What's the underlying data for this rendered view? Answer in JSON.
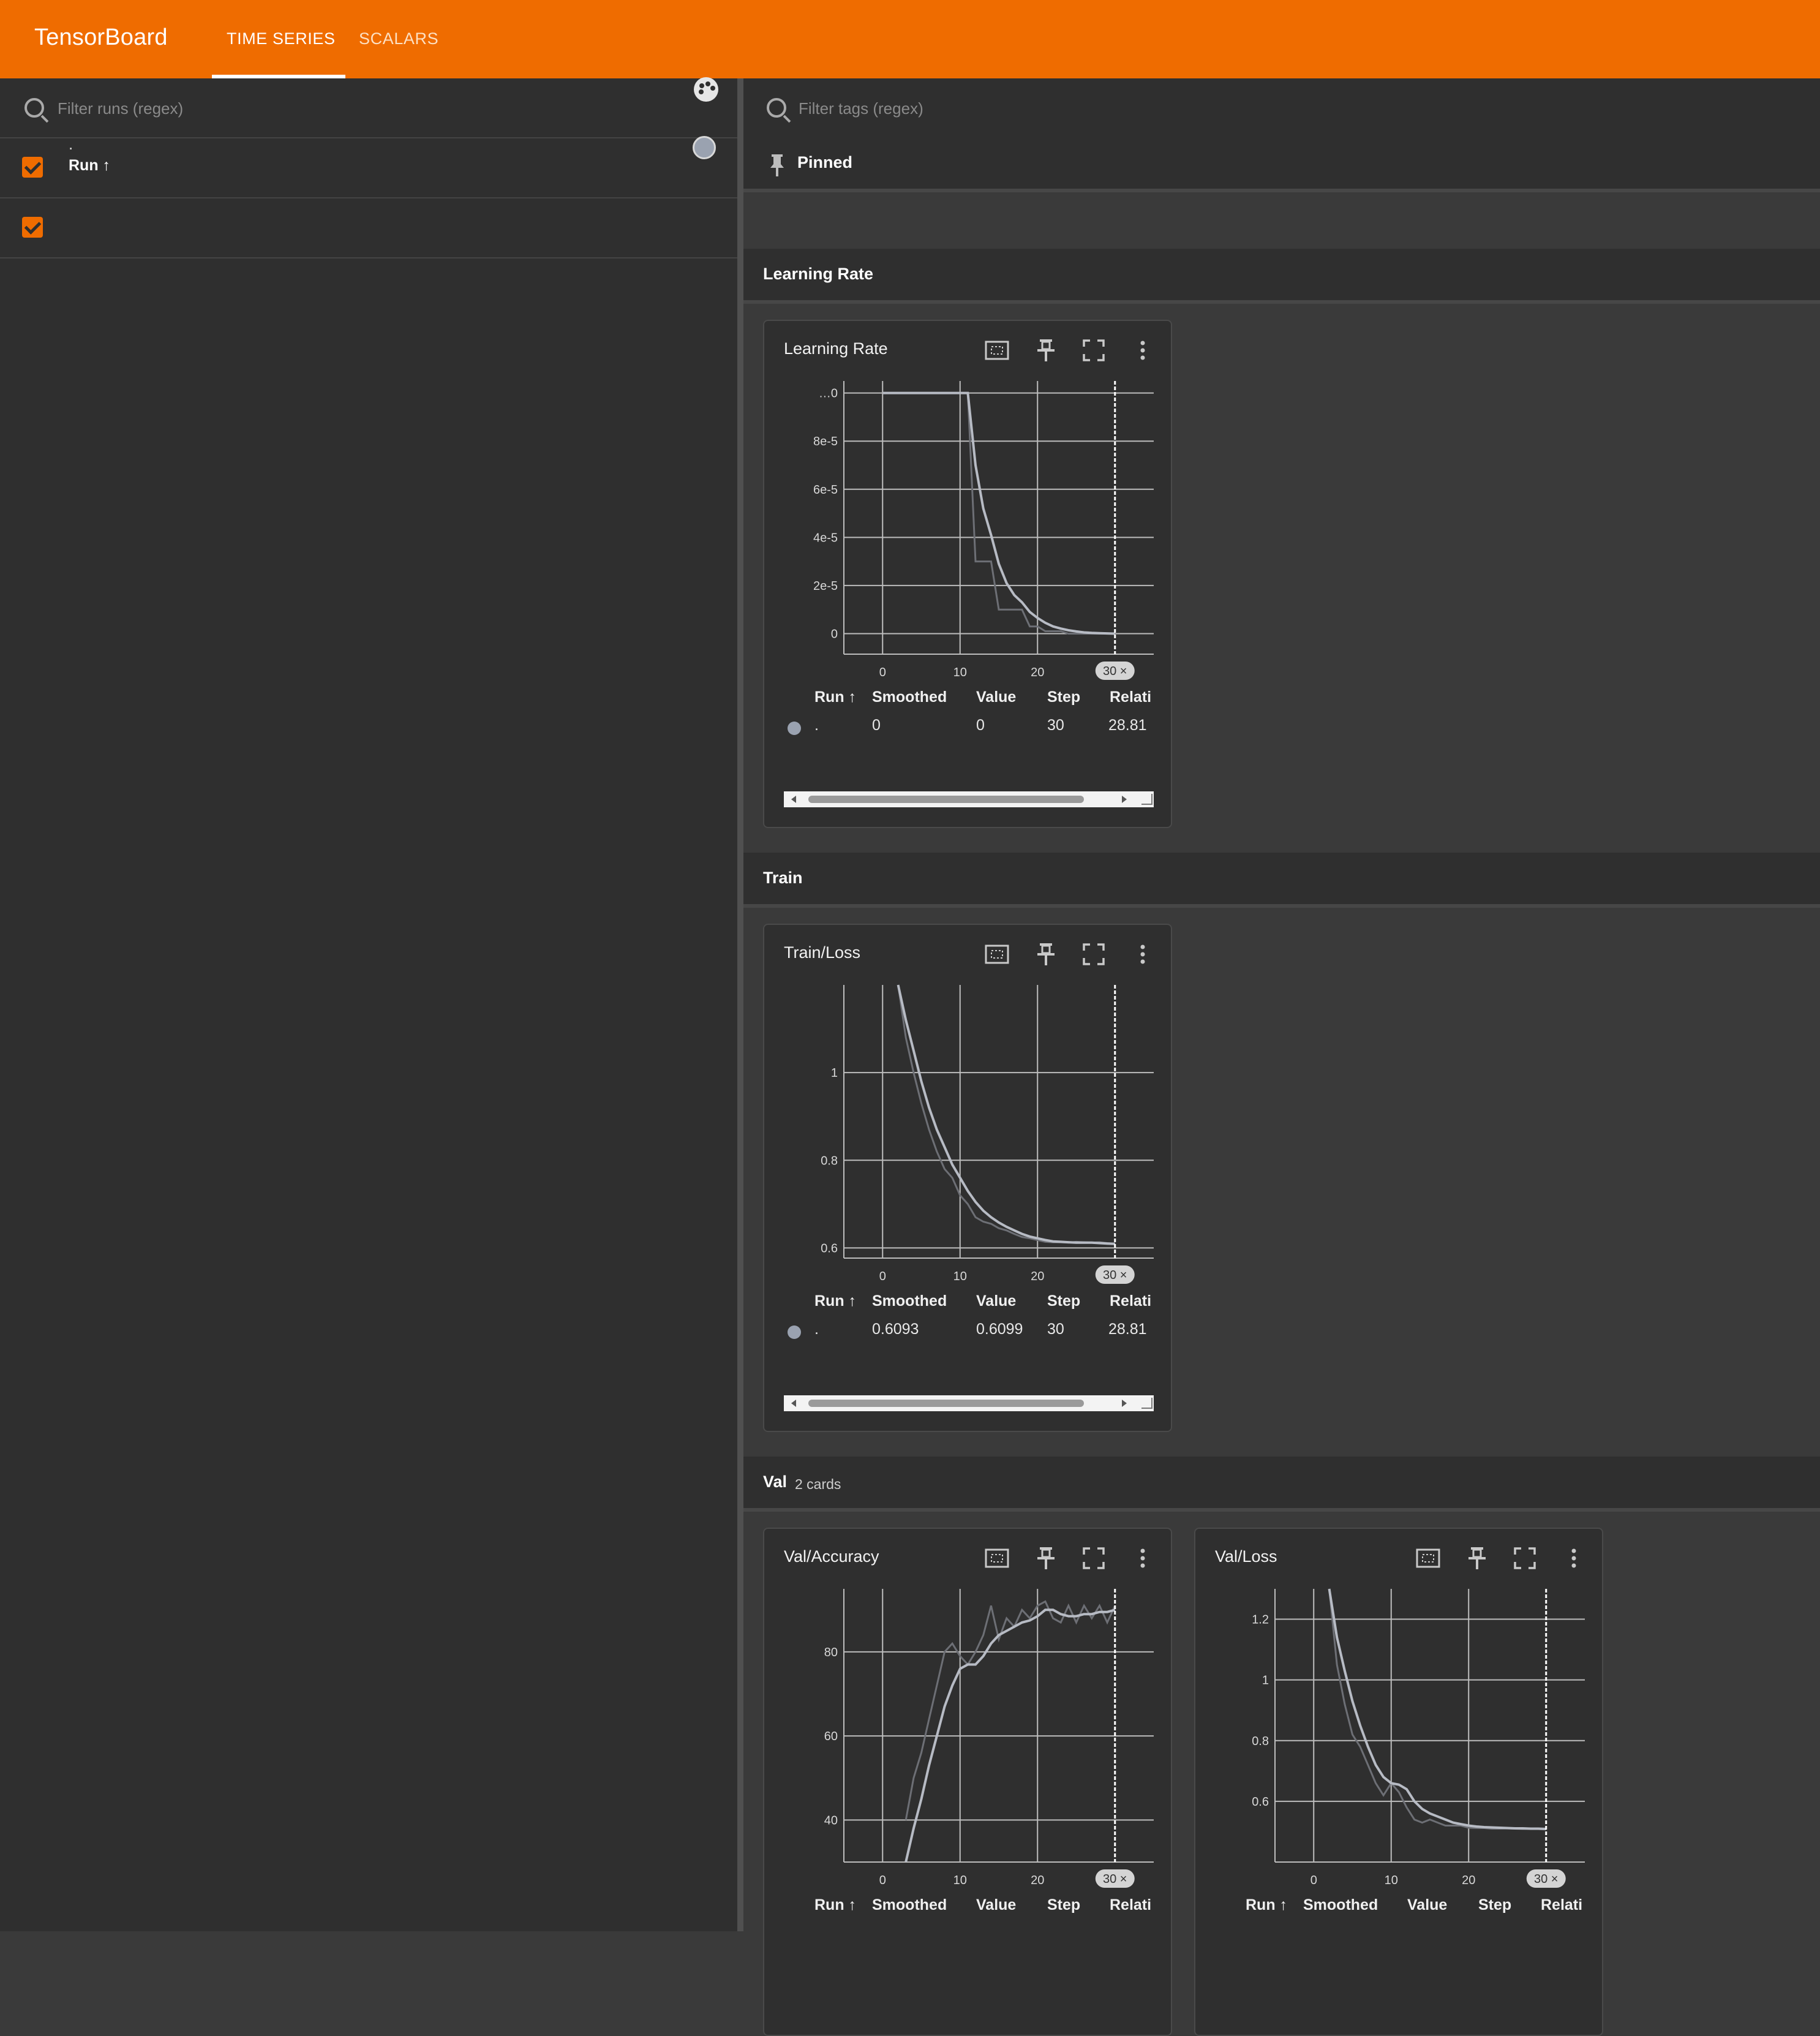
{
  "app": {
    "brand": "TensorBoard",
    "tabs": [
      {
        "label": "TIME SERIES",
        "active": true
      },
      {
        "label": "SCALARS",
        "active": false
      }
    ],
    "accent": "#ef6c00"
  },
  "sidebar": {
    "filter_placeholder": "Filter runs (regex)",
    "run_header": "Run ↑",
    "runs": [
      {
        "name": ".",
        "checked": true,
        "color": "#9aa2b0"
      }
    ]
  },
  "main": {
    "filter_placeholder": "Filter tags (regex)",
    "pinned_label": "Pinned",
    "sections": [
      {
        "title": "Learning Rate",
        "subtitle": ""
      },
      {
        "title": "Train",
        "subtitle": ""
      },
      {
        "title": "Val",
        "subtitle": "2 cards"
      }
    ],
    "table_headers": {
      "run": "Run ↑",
      "smoothed": "Smoothed",
      "value": "Value",
      "step": "Step",
      "relative": "Relati"
    },
    "step_badge": "30 ×",
    "cards": [
      {
        "title": "Learning Rate",
        "row": {
          "run": ".",
          "smoothed": "0",
          "value": "0",
          "step": "30",
          "relative": "28.81"
        }
      },
      {
        "title": "Train/Loss",
        "row": {
          "run": ".",
          "smoothed": "0.6093",
          "value": "0.6099",
          "step": "30",
          "relative": "28.81"
        }
      },
      {
        "title": "Val/Accuracy"
      },
      {
        "title": "Val/Loss"
      }
    ]
  },
  "chart_data": [
    {
      "type": "line",
      "title": "Learning Rate",
      "x_ticks": [
        "0",
        "10",
        "20"
      ],
      "y_ticks": [
        "0",
        "2e-5",
        "4e-5",
        "6e-5",
        "8e-5",
        "…0"
      ],
      "xlim": [
        -5,
        35
      ],
      "ylim": [
        -8.54e-06,
        0.000105
      ],
      "step_marker": 30,
      "series": [
        {
          "role": "raw",
          "color": "#6d6f75",
          "x": [
            0,
            1,
            2,
            3,
            4,
            5,
            6,
            7,
            8,
            9,
            10,
            11,
            12,
            13,
            14,
            15,
            16,
            17,
            18,
            19,
            20,
            21,
            22,
            23,
            24,
            25,
            26,
            27,
            28,
            29,
            30
          ],
          "y": [
            0.0001,
            0.0001,
            0.0001,
            0.0001,
            0.0001,
            0.0001,
            0.0001,
            0.0001,
            0.0001,
            0.0001,
            0.0001,
            0.0001,
            3e-05,
            3e-05,
            3e-05,
            1e-05,
            1e-05,
            1e-05,
            1e-05,
            3e-06,
            3e-06,
            1e-06,
            1e-06,
            1e-06,
            0,
            0,
            0,
            0,
            0,
            0,
            0
          ]
        },
        {
          "role": "smoothed",
          "color": "#b7bbc4",
          "x": [
            0,
            1,
            2,
            3,
            4,
            5,
            6,
            7,
            8,
            9,
            10,
            11,
            12,
            13,
            14,
            15,
            16,
            17,
            18,
            19,
            20,
            21,
            22,
            23,
            24,
            25,
            26,
            27,
            28,
            29,
            30
          ],
          "y": [
            0.0001,
            0.0001,
            0.0001,
            0.0001,
            0.0001,
            0.0001,
            0.0001,
            0.0001,
            0.0001,
            0.0001,
            0.0001,
            0.0001,
            7e-05,
            5.2e-05,
            4.1e-05,
            2.9e-05,
            2.1e-05,
            1.6e-05,
            1.3e-05,
            9e-06,
            6.5e-06,
            4.5e-06,
            3e-06,
            2.1e-06,
            1.4e-06,
            9e-07,
            5e-07,
            3e-07,
            2e-07,
            1e-07,
            0
          ]
        }
      ]
    },
    {
      "type": "line",
      "title": "Train/Loss",
      "x_ticks": [
        "0",
        "10",
        "20"
      ],
      "y_ticks": [
        "0.6",
        "0.8",
        "1"
      ],
      "xlim": [
        -5,
        35
      ],
      "ylim": [
        0.5768,
        1.2
      ],
      "step_marker": 30,
      "series": [
        {
          "role": "raw",
          "color": "#6d6f75",
          "x": [
            2,
            3,
            4,
            5,
            6,
            7,
            8,
            9,
            10,
            11,
            12,
            13,
            14,
            15,
            16,
            17,
            18,
            19,
            20,
            21,
            22,
            23,
            24,
            25,
            26,
            27,
            28,
            29,
            30
          ],
          "y": [
            1.2,
            1.08,
            1.0,
            0.93,
            0.87,
            0.82,
            0.78,
            0.76,
            0.72,
            0.7,
            0.67,
            0.66,
            0.655,
            0.645,
            0.64,
            0.632,
            0.625,
            0.622,
            0.618,
            0.614,
            0.613,
            0.613,
            0.612,
            0.614,
            0.613,
            0.612,
            0.613,
            0.611,
            0.6099
          ]
        },
        {
          "role": "smoothed",
          "color": "#b7bbc4",
          "x": [
            2,
            3,
            4,
            5,
            6,
            7,
            8,
            9,
            10,
            11,
            12,
            13,
            14,
            15,
            16,
            17,
            18,
            19,
            20,
            21,
            22,
            23,
            24,
            25,
            26,
            27,
            28,
            29,
            30
          ],
          "y": [
            1.2,
            1.12,
            1.05,
            0.98,
            0.92,
            0.87,
            0.83,
            0.79,
            0.76,
            0.73,
            0.705,
            0.685,
            0.67,
            0.658,
            0.648,
            0.64,
            0.632,
            0.626,
            0.622,
            0.618,
            0.615,
            0.614,
            0.613,
            0.612,
            0.612,
            0.612,
            0.611,
            0.61,
            0.6093
          ]
        }
      ]
    },
    {
      "type": "line",
      "title": "Val/Accuracy",
      "x_ticks": [
        "0",
        "10",
        "20"
      ],
      "y_ticks": [
        "40",
        "60",
        "80"
      ],
      "xlim": [
        -5,
        35
      ],
      "ylim": [
        30,
        95
      ],
      "step_marker": 30,
      "series": [
        {
          "role": "raw",
          "color": "#6d6f75",
          "x": [
            3,
            4,
            5,
            6,
            7,
            8,
            9,
            10,
            11,
            12,
            13,
            14,
            15,
            16,
            17,
            18,
            19,
            20,
            21,
            22,
            23,
            24,
            25,
            26,
            27,
            28,
            29,
            30
          ],
          "y": [
            40,
            50,
            56,
            64,
            72,
            80,
            82,
            79,
            77,
            80,
            84,
            91,
            83,
            88,
            86,
            90,
            88,
            91,
            92,
            88,
            87,
            91,
            87,
            91,
            88,
            91,
            87,
            91
          ]
        },
        {
          "role": "smoothed",
          "color": "#b7bbc4",
          "x": [
            3,
            4,
            5,
            6,
            7,
            8,
            9,
            10,
            11,
            12,
            13,
            14,
            15,
            16,
            17,
            18,
            19,
            20,
            21,
            22,
            23,
            24,
            25,
            26,
            27,
            28,
            29,
            30
          ],
          "y": [
            30,
            38,
            45,
            53,
            60,
            67,
            72,
            76,
            77,
            77,
            79,
            82,
            84,
            85,
            86,
            87,
            87.5,
            88.5,
            90,
            90,
            89,
            88.5,
            88.5,
            89,
            89,
            89.5,
            89.5,
            90
          ]
        }
      ]
    },
    {
      "type": "line",
      "title": "Val/Loss",
      "x_ticks": [
        "0",
        "10",
        "20"
      ],
      "y_ticks": [
        "0.6",
        "0.8",
        "1",
        "1.2"
      ],
      "xlim": [
        -5,
        35
      ],
      "ylim": [
        0.4,
        1.3
      ],
      "step_marker": 30,
      "series": [
        {
          "role": "raw",
          "color": "#6d6f75",
          "x": [
            2,
            3,
            4,
            5,
            6,
            7,
            8,
            9,
            10,
            11,
            12,
            13,
            14,
            15,
            16,
            17,
            18,
            19,
            20,
            21,
            22,
            23,
            24,
            25,
            26,
            27,
            28,
            29,
            30
          ],
          "y": [
            1.3,
            1.05,
            0.92,
            0.82,
            0.78,
            0.72,
            0.66,
            0.62,
            0.66,
            0.63,
            0.58,
            0.54,
            0.53,
            0.54,
            0.53,
            0.52,
            0.52,
            0.52,
            0.513,
            0.512,
            0.512,
            0.51,
            0.51,
            0.511,
            0.51,
            0.509,
            0.51,
            0.509,
            0.508
          ]
        },
        {
          "role": "smoothed",
          "color": "#b7bbc4",
          "x": [
            2,
            3,
            4,
            5,
            6,
            7,
            8,
            9,
            10,
            11,
            12,
            13,
            14,
            15,
            16,
            17,
            18,
            19,
            20,
            21,
            22,
            23,
            24,
            25,
            26,
            27,
            28,
            29,
            30
          ],
          "y": [
            1.3,
            1.14,
            1.03,
            0.93,
            0.85,
            0.78,
            0.72,
            0.68,
            0.66,
            0.655,
            0.64,
            0.6,
            0.575,
            0.56,
            0.55,
            0.54,
            0.53,
            0.525,
            0.52,
            0.517,
            0.515,
            0.514,
            0.513,
            0.512,
            0.511,
            0.511,
            0.51,
            0.51,
            0.509
          ]
        }
      ]
    }
  ]
}
